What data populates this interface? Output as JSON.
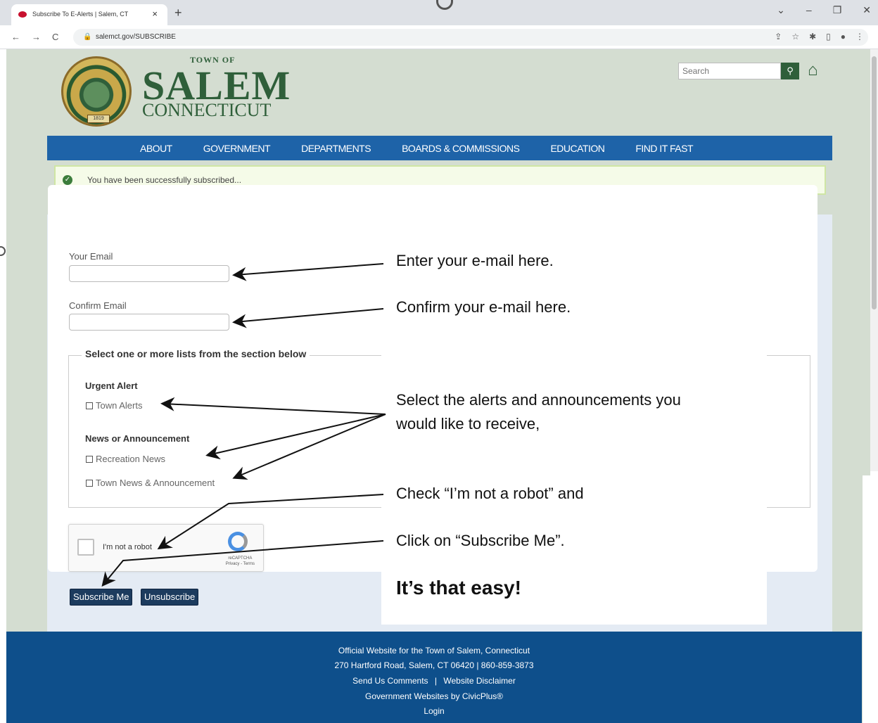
{
  "browser": {
    "tab_title": "Subscribe To E-Alerts | Salem, CT",
    "tab_close": "×",
    "new_tab": "+",
    "url": "salemct.gov/SUBSCRIBE",
    "window_controls": [
      "⌄",
      "–",
      "❐",
      "✕"
    ]
  },
  "header": {
    "town_of": "TOWN OF",
    "salem": "SALEM",
    "connecticut": "CONNECTICUT",
    "seal_year": "1819",
    "search_placeholder": "Search"
  },
  "nav": {
    "items": [
      "ABOUT",
      "GOVERNMENT",
      "DEPARTMENTS",
      "BOARDS & COMMISSIONS",
      "EDUCATION",
      "FIND IT FAST"
    ]
  },
  "alert": {
    "message": "You have been successfully subscribed..."
  },
  "form": {
    "email_label": "Your Email",
    "confirm_label": "Confirm Email",
    "legend": "Select one or more lists from the section below",
    "group1": "Urgent Alert",
    "cb_town_alerts": "Town Alerts",
    "group2": "News or Announcement",
    "cb_recreation": "Recreation News",
    "cb_town_news": "Town News & Announcement",
    "recaptcha_text": "I'm not a robot",
    "recaptcha_brand": "reCAPTCHA\nPrivacy - Terms",
    "subscribe_button": "Subscribe Me",
    "unsubscribe_button": "Unsubscribe"
  },
  "annotations": {
    "email": "Enter your e-mail here.",
    "confirm": "Confirm your e-mail here.",
    "select_line1": "Select the alerts and announcements you",
    "select_line2": "would like to receive,",
    "robot": "Check “I’m not a robot” and",
    "subscribe": "Click on “Subscribe Me”.",
    "easy": "It’s that easy!"
  },
  "footer": {
    "line1": "Official Website for the Town of Salem, Connecticut",
    "line2": "270 Hartford Road, Salem, CT 06420 | 860-859-3873",
    "comments": "Send Us Comments",
    "separator": "|",
    "disclaimer": "Website Disclaimer",
    "civicplus": "Government Websites by CivicPlus®",
    "login": "Login"
  },
  "colors": {
    "nav_blue": "#1e63a8",
    "footer_blue": "#0e4f8b",
    "logo_green": "#2f5f3a",
    "page_bg": "#d4ddd1"
  }
}
